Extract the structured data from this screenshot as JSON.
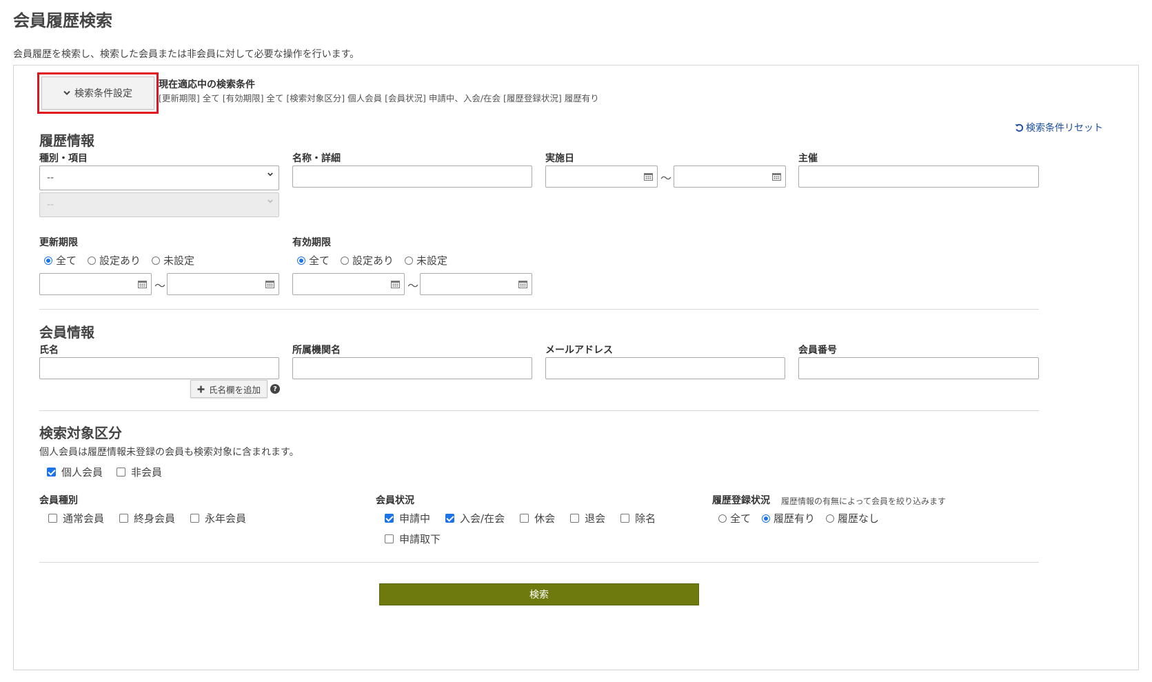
{
  "page": {
    "title": "会員履歴検索",
    "description": "会員履歴を検索し、検索した会員または非会員に対して必要な操作を行います。"
  },
  "conditions": {
    "toggle_label": "検索条件設定",
    "current_title": "現在適応中の検索条件",
    "current_text": "[更新期限] 全て [有効期限] 全て [検索対象区分] 個人会員 [会員状況] 申請中、入会/在会 [履歴登録状況] 履歴有り",
    "reset_label": "検索条件リセット"
  },
  "history": {
    "heading": "履歴情報",
    "type_label": "種別・項目",
    "type_value": "--",
    "subtype_value": "--",
    "name_label": "名称・詳細",
    "date_label": "実施日",
    "host_label": "主催",
    "tilde": "～"
  },
  "renewal": {
    "label": "更新期限",
    "options": [
      "全て",
      "設定あり",
      "未設定"
    ],
    "selected": "全て"
  },
  "validity": {
    "label": "有効期限",
    "options": [
      "全て",
      "設定あり",
      "未設定"
    ],
    "selected": "全て"
  },
  "member": {
    "heading": "会員情報",
    "name_label": "氏名",
    "org_label": "所属機関名",
    "email_label": "メールアドレス",
    "number_label": "会員番号",
    "add_name_label": "氏名欄を追加"
  },
  "target": {
    "heading": "検索対象区分",
    "note": "個人会員は履歴情報未登録の会員も検索対象に含まれます。",
    "options": [
      {
        "label": "個人会員",
        "checked": true
      },
      {
        "label": "非会員",
        "checked": false
      }
    ]
  },
  "member_type": {
    "label": "会員種別",
    "options": [
      {
        "label": "通常会員",
        "checked": false
      },
      {
        "label": "終身会員",
        "checked": false
      },
      {
        "label": "永年会員",
        "checked": false
      }
    ]
  },
  "member_status": {
    "label": "会員状況",
    "options": [
      {
        "label": "申請中",
        "checked": true
      },
      {
        "label": "入会/在会",
        "checked": true
      },
      {
        "label": "休会",
        "checked": false
      },
      {
        "label": "退会",
        "checked": false
      },
      {
        "label": "除名",
        "checked": false
      },
      {
        "label": "申請取下",
        "checked": false
      }
    ]
  },
  "registration": {
    "label": "履歴登録状況",
    "note": "履歴情報の有無によって会員を絞り込みます",
    "options": [
      "全て",
      "履歴有り",
      "履歴なし"
    ],
    "selected": "履歴有り"
  },
  "search_button": "検索",
  "colors": {
    "accent": "#1a73e8",
    "highlight": "#e0141e",
    "submit": "#6e7a0e",
    "link": "#1a4fa0"
  }
}
